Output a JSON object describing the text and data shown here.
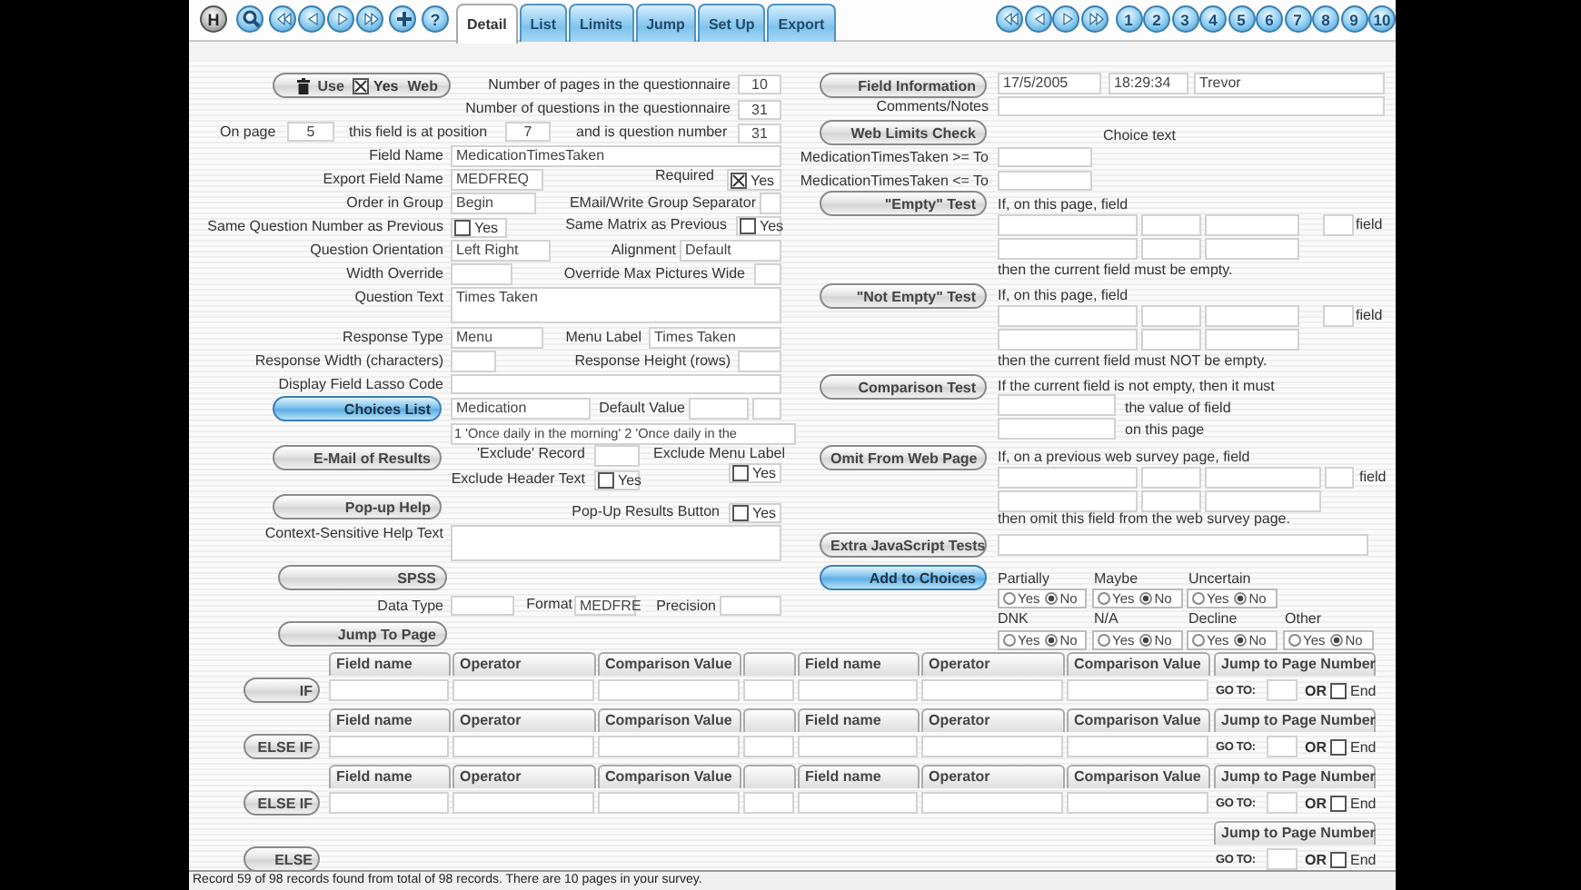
{
  "toolbar": {
    "home": "H",
    "help": "?",
    "tabs": [
      {
        "label": "Detail",
        "selected": true
      },
      {
        "label": "List",
        "selected": false
      },
      {
        "label": "Limits",
        "selected": false
      },
      {
        "label": "Jump",
        "selected": false
      },
      {
        "label": "Set Up",
        "selected": false
      },
      {
        "label": "Export",
        "selected": false
      }
    ],
    "pages": [
      "1",
      "2",
      "3",
      "4",
      "5",
      "6",
      "7",
      "8",
      "9",
      "10"
    ]
  },
  "form": {
    "items": [
      {
        "kind": "use_button",
        "label": "Use",
        "checkbox": {
          "label": "Yes",
          "checked": true
        },
        "trailing": "Web"
      },
      {
        "kind": "label",
        "text": "Number of pages in the questionnaire"
      },
      {
        "kind": "field",
        "value": "10"
      },
      {
        "kind": "label",
        "text": "Number of questions in the questionnaire"
      },
      {
        "kind": "field",
        "value": "31"
      },
      {
        "kind": "label",
        "text": "On page"
      },
      {
        "kind": "field",
        "value": "5"
      },
      {
        "kind": "label",
        "text": "this field is at position"
      },
      {
        "kind": "field",
        "value": "7"
      },
      {
        "kind": "label",
        "text": "and is question number"
      },
      {
        "kind": "field",
        "value": "31"
      },
      {
        "kind": "label",
        "text": "Field Name"
      },
      {
        "kind": "field",
        "value": "MedicationTimesTaken"
      },
      {
        "kind": "label",
        "text": "Export Field Name"
      },
      {
        "kind": "field",
        "value": "MEDFREQ"
      },
      {
        "kind": "label",
        "text": "Required"
      },
      {
        "kind": "checkbox",
        "label": "Yes",
        "checked": true
      },
      {
        "kind": "label",
        "text": "Order in Group"
      },
      {
        "kind": "field",
        "value": "Begin"
      },
      {
        "kind": "label",
        "text": "EMail/Write Group Separator"
      },
      {
        "kind": "field"
      },
      {
        "kind": "label",
        "text": "Same Question Number as Previous"
      },
      {
        "kind": "checkbox",
        "label": "Yes",
        "checked": false
      },
      {
        "kind": "label",
        "text": "Same Matrix as Previous"
      },
      {
        "kind": "checkbox",
        "label": "Yes",
        "checked": false
      },
      {
        "kind": "label",
        "text": "Question Orientation"
      },
      {
        "kind": "field",
        "value": "Left Right"
      },
      {
        "kind": "label",
        "text": "Alignment"
      },
      {
        "kind": "field",
        "value": "Default"
      },
      {
        "kind": "label",
        "text": "Width Override"
      },
      {
        "kind": "field"
      },
      {
        "kind": "label",
        "text": "Override Max Pictures Wide"
      },
      {
        "kind": "field"
      },
      {
        "kind": "label",
        "text": "Question Text"
      },
      {
        "kind": "field",
        "value": "Times Taken"
      },
      {
        "kind": "label",
        "text": "Response Type"
      },
      {
        "kind": "field",
        "value": "Menu"
      },
      {
        "kind": "label",
        "text": "Menu Label"
      },
      {
        "kind": "field",
        "value": "Times Taken"
      },
      {
        "kind": "label",
        "text": "Response Width (characters)"
      },
      {
        "kind": "field"
      },
      {
        "kind": "label",
        "text": "Response Height (rows)"
      },
      {
        "kind": "field"
      },
      {
        "kind": "label",
        "text": "Display Field Lasso Code"
      },
      {
        "kind": "field"
      },
      {
        "kind": "button",
        "label": "Choices List",
        "highlighted": true
      },
      {
        "kind": "field",
        "value": "Medication"
      },
      {
        "kind": "label",
        "text": "Default Value"
      },
      {
        "kind": "field"
      },
      {
        "kind": "field"
      },
      {
        "kind": "field",
        "value": "1 'Once daily in the morning' 2 'Once daily in the"
      },
      {
        "kind": "button",
        "label": "E-Mail of Results",
        "highlighted": false
      },
      {
        "kind": "label",
        "text": "'Exclude' Record"
      },
      {
        "kind": "field"
      },
      {
        "kind": "label",
        "text": "Exclude Menu Label"
      },
      {
        "kind": "checkbox",
        "label": "Yes",
        "checked": false
      },
      {
        "kind": "label",
        "text": "Exclude Header Text"
      },
      {
        "kind": "checkbox",
        "label": "Yes",
        "checked": false
      },
      {
        "kind": "button",
        "label": "Pop-up Help",
        "highlighted": false
      },
      {
        "kind": "label",
        "text": "Pop-Up Results Button"
      },
      {
        "kind": "checkbox",
        "label": "Yes",
        "checked": false
      },
      {
        "kind": "label",
        "text": "Context-Sensitive Help Text"
      },
      {
        "kind": "field"
      },
      {
        "kind": "button",
        "label": "SPSS",
        "highlighted": false
      },
      {
        "kind": "label",
        "text": "Data Type"
      },
      {
        "kind": "field"
      },
      {
        "kind": "label",
        "text": "Format"
      },
      {
        "kind": "field",
        "value": "MEDFRE"
      },
      {
        "kind": "label",
        "text": "Precision"
      },
      {
        "kind": "field"
      },
      {
        "kind": "button",
        "label": "Jump To Page",
        "highlighted": false
      },
      {
        "kind": "button",
        "label": "Field Information",
        "highlighted": false
      },
      {
        "kind": "field",
        "value": "17/5/2005"
      },
      {
        "kind": "field",
        "value": "18:29:34"
      },
      {
        "kind": "field",
        "value": "Trevor"
      },
      {
        "kind": "label",
        "text": "Comments/Notes"
      },
      {
        "kind": "field"
      },
      {
        "kind": "button",
        "label": "Web Limits Check",
        "highlighted": false
      },
      {
        "kind": "label",
        "text": "Choice text"
      },
      {
        "kind": "label",
        "text": "MedicationTimesTaken >= To"
      },
      {
        "kind": "field"
      },
      {
        "kind": "label",
        "text": "MedicationTimesTaken <= To"
      },
      {
        "kind": "field"
      },
      {
        "kind": "button",
        "label": "\"Empty\" Test",
        "highlighted": false
      },
      {
        "kind": "label",
        "text": "If, on this page, field"
      },
      {
        "kind": "field"
      },
      {
        "kind": "field"
      },
      {
        "kind": "field"
      },
      {
        "kind": "field"
      },
      {
        "kind": "label",
        "text": "field"
      },
      {
        "kind": "field"
      },
      {
        "kind": "field"
      },
      {
        "kind": "field"
      },
      {
        "kind": "label",
        "text": "then the current field must be empty."
      },
      {
        "kind": "button",
        "label": "\"Not Empty\" Test",
        "highlighted": false
      },
      {
        "kind": "label",
        "text": "If, on this page, field"
      },
      {
        "kind": "field"
      },
      {
        "kind": "field"
      },
      {
        "kind": "field"
      },
      {
        "kind": "field"
      },
      {
        "kind": "label",
        "text": "field"
      },
      {
        "kind": "field"
      },
      {
        "kind": "field"
      },
      {
        "kind": "field"
      },
      {
        "kind": "label",
        "text": "then the current field must NOT be empty."
      },
      {
        "kind": "button",
        "label": "Comparison Test",
        "highlighted": false
      },
      {
        "kind": "label",
        "text": "If the current field is not empty, then it must"
      },
      {
        "kind": "field"
      },
      {
        "kind": "label",
        "text": "the value of field"
      },
      {
        "kind": "field"
      },
      {
        "kind": "label",
        "text": "on this page"
      },
      {
        "kind": "button",
        "label": "Omit From Web Page",
        "highlighted": false
      },
      {
        "kind": "label",
        "text": "If, on a previous web survey page, field"
      },
      {
        "kind": "field"
      },
      {
        "kind": "field"
      },
      {
        "kind": "field"
      },
      {
        "kind": "field"
      },
      {
        "kind": "label",
        "text": "field"
      },
      {
        "kind": "field"
      },
      {
        "kind": "field"
      },
      {
        "kind": "field"
      },
      {
        "kind": "label",
        "text": "then omit this field from the web survey page."
      },
      {
        "kind": "button",
        "label": "Extra JavaScript Tests",
        "highlighted": false
      },
      {
        "kind": "field"
      },
      {
        "kind": "button",
        "label": "Add to Choices",
        "highlighted": true
      },
      {
        "kind": "label",
        "text": "Partially"
      },
      {
        "kind": "label",
        "text": "Maybe"
      },
      {
        "kind": "label",
        "text": "Uncertain"
      },
      {
        "kind": "radio",
        "options": [
          {
            "label": "Yes",
            "selected": false
          },
          {
            "label": "No",
            "selected": true
          }
        ]
      },
      {
        "kind": "radio",
        "options": [
          {
            "label": "Yes",
            "selected": false
          },
          {
            "label": "No",
            "selected": true
          }
        ]
      },
      {
        "kind": "radio",
        "options": [
          {
            "label": "Yes",
            "selected": false
          },
          {
            "label": "No",
            "selected": true
          }
        ]
      },
      {
        "kind": "label",
        "text": "DNK"
      },
      {
        "kind": "label",
        "text": "N/A"
      },
      {
        "kind": "label",
        "text": "Decline"
      },
      {
        "kind": "label",
        "text": "Other"
      },
      {
        "kind": "radio",
        "options": [
          {
            "label": "Yes",
            "selected": false
          },
          {
            "label": "No",
            "selected": true
          }
        ]
      },
      {
        "kind": "radio",
        "options": [
          {
            "label": "Yes",
            "selected": false
          },
          {
            "label": "No",
            "selected": true
          }
        ]
      },
      {
        "kind": "radio",
        "options": [
          {
            "label": "Yes",
            "selected": false
          },
          {
            "label": "No",
            "selected": true
          }
        ]
      },
      {
        "kind": "radio",
        "options": [
          {
            "label": "Yes",
            "selected": false
          },
          {
            "label": "No",
            "selected": true
          }
        ]
      }
    ]
  },
  "rules": [
    {
      "button": "IF",
      "headers": [
        "Field name",
        "Operator",
        "Comparison Value",
        "Field name",
        "Operator",
        "Comparison Value"
      ],
      "jump_header": "Jump to Page Number",
      "goto": "GO TO:",
      "or": "OR",
      "end": {
        "label": "End",
        "checked": false
      }
    },
    {
      "button": "ELSE  IF",
      "headers": [
        "Field name",
        "Operator",
        "Comparison Value",
        "Field name",
        "Operator",
        "Comparison Value"
      ],
      "jump_header": "Jump to Page Number",
      "goto": "GO TO:",
      "or": "OR",
      "end": {
        "label": "End",
        "checked": false
      }
    },
    {
      "button": "ELSE  IF",
      "headers": [
        "Field name",
        "Operator",
        "Comparison Value",
        "Field name",
        "Operator",
        "Comparison Value"
      ],
      "jump_header": "Jump to Page Number",
      "goto": "GO TO:",
      "or": "OR",
      "end": {
        "label": "End",
        "checked": false
      }
    },
    {
      "button": "ELSE",
      "jump_header": "Jump to Page Number",
      "goto": "GO TO:",
      "or": "OR",
      "end": {
        "label": "End",
        "checked": false
      }
    }
  ],
  "status_bar": "Record 59 of 98 records found from total of 98 records.  There are 10 pages in your survey."
}
